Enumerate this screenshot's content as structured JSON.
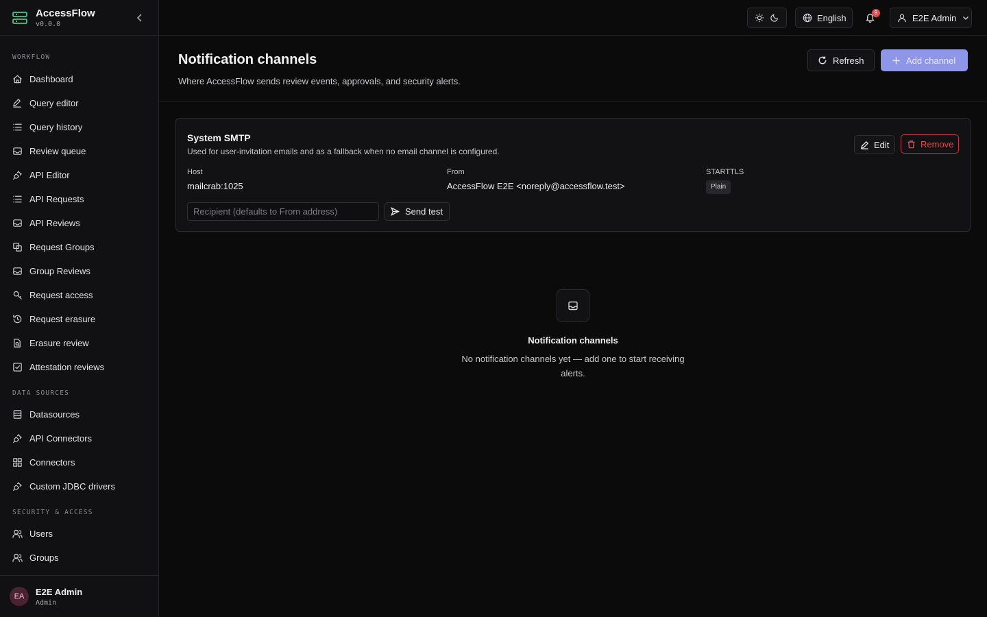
{
  "app": {
    "name": "AccessFlow",
    "version": "v0.0.0"
  },
  "sidebar": {
    "sections": [
      {
        "title": "WORKFLOW",
        "items": [
          {
            "label": "Dashboard",
            "icon": "home-icon"
          },
          {
            "label": "Query editor",
            "icon": "pencil-icon"
          },
          {
            "label": "Query history",
            "icon": "list-icon"
          },
          {
            "label": "Review queue",
            "icon": "inbox-icon"
          },
          {
            "label": "API Editor",
            "icon": "plug-icon"
          },
          {
            "label": "API Requests",
            "icon": "list-icon"
          },
          {
            "label": "API Reviews",
            "icon": "inbox-icon"
          },
          {
            "label": "Request Groups",
            "icon": "layers-icon"
          },
          {
            "label": "Group Reviews",
            "icon": "inbox-icon"
          },
          {
            "label": "Request access",
            "icon": "key-icon"
          },
          {
            "label": "Request erasure",
            "icon": "history-icon"
          },
          {
            "label": "Erasure review",
            "icon": "file-search-icon"
          },
          {
            "label": "Attestation reviews",
            "icon": "check-square-icon"
          }
        ]
      },
      {
        "title": "DATA SOURCES",
        "items": [
          {
            "label": "Datasources",
            "icon": "server-icon"
          },
          {
            "label": "API Connectors",
            "icon": "plug-icon"
          },
          {
            "label": "Connectors",
            "icon": "grid-icon"
          },
          {
            "label": "Custom JDBC drivers",
            "icon": "plug-icon"
          }
        ]
      },
      {
        "title": "SECURITY & ACCESS",
        "items": [
          {
            "label": "Users",
            "icon": "users-icon"
          },
          {
            "label": "Groups",
            "icon": "users-icon"
          }
        ]
      }
    ],
    "footer": {
      "initials": "EA",
      "name": "E2E Admin",
      "role": "Admin"
    }
  },
  "topbar": {
    "language": "English",
    "notifications_count": "9",
    "user": "E2E Admin"
  },
  "page": {
    "title": "Notification channels",
    "subtitle": "Where AccessFlow sends review events, approvals, and security alerts.",
    "refresh_label": "Refresh",
    "add_label": "Add channel"
  },
  "smtp": {
    "title": "System SMTP",
    "description": "Used for user-invitation emails and as a fallback when no email channel is configured.",
    "edit_label": "Edit",
    "remove_label": "Remove",
    "host_label": "Host",
    "host_value": "mailcrab:1025",
    "from_label": "From",
    "from_value": "AccessFlow E2E <noreply@accessflow.test>",
    "starttls_label": "STARTTLS",
    "starttls_value": "Plain",
    "recipient_placeholder": "Recipient (defaults to From address)",
    "send_label": "Send test"
  },
  "empty": {
    "title": "Notification channels",
    "text": "No notification channels yet — add one to start receiving alerts."
  },
  "colors": {
    "accent": "#8d96e8",
    "danger": "#e5484d",
    "background": "#0b0b0c",
    "sidebar": "#111113"
  }
}
